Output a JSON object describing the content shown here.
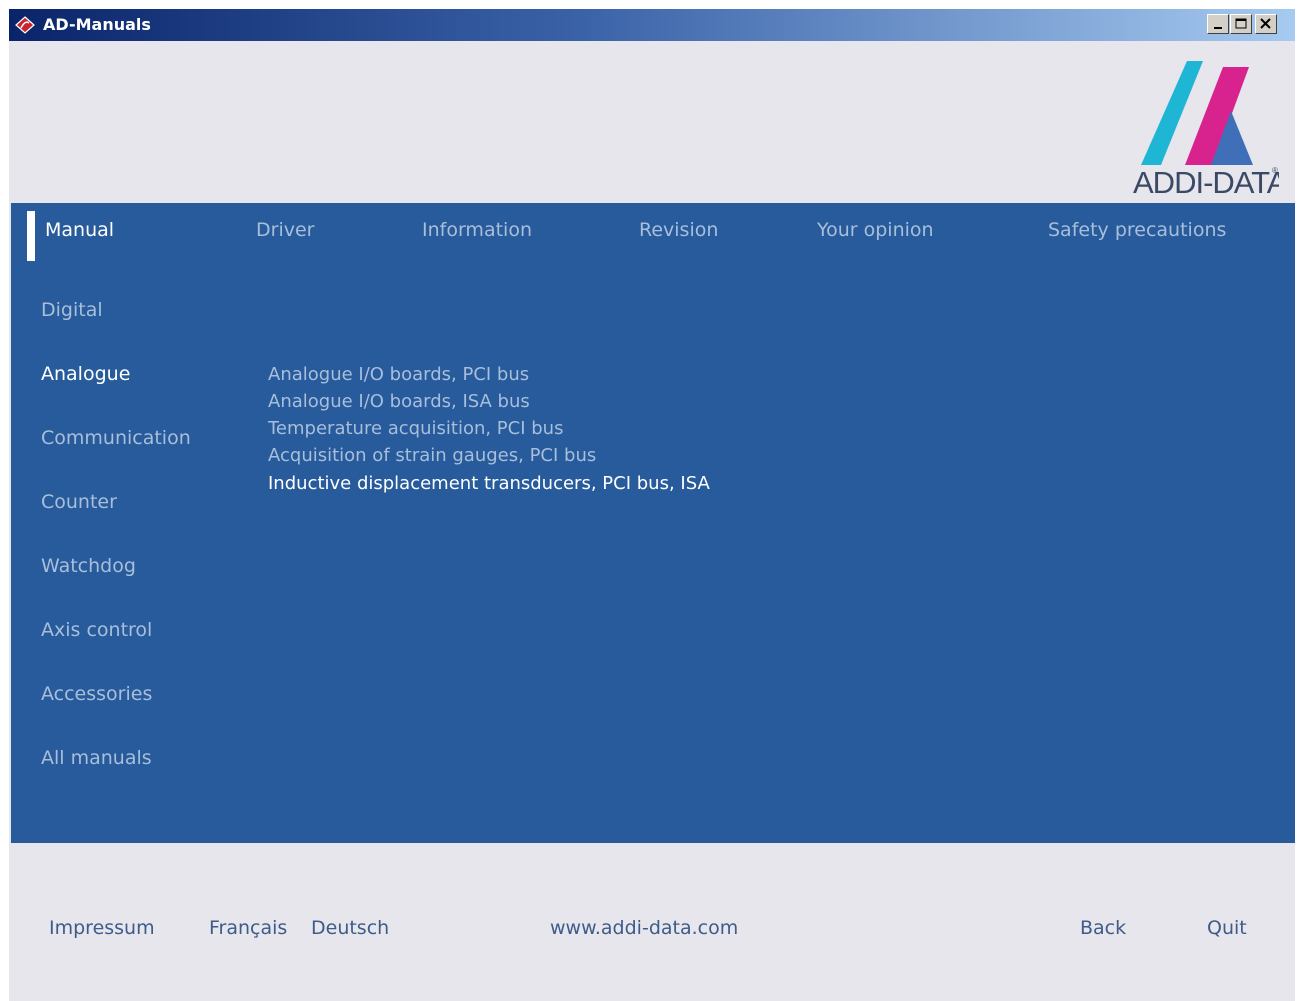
{
  "window": {
    "title": "AD-Manuals",
    "app_icon": "diamond-app-icon",
    "controls": [
      "minimize-icon",
      "maximize-icon",
      "close-icon"
    ]
  },
  "logo": {
    "text": "ADDI-DATA",
    "mark": "®",
    "colors": [
      "#1fb6d6",
      "#d8238f",
      "#3e6fb8"
    ]
  },
  "top_nav": {
    "items": [
      {
        "label": "Manual",
        "active": true
      },
      {
        "label": "Driver"
      },
      {
        "label": "Information"
      },
      {
        "label": "Revision"
      },
      {
        "label": "Your opinion"
      },
      {
        "label": "Safety precautions"
      }
    ]
  },
  "categories": {
    "items": [
      {
        "label": "Digital"
      },
      {
        "label": "Analogue",
        "active": true
      },
      {
        "label": "Communication"
      },
      {
        "label": "Counter"
      },
      {
        "label": "Watchdog"
      },
      {
        "label": "Axis control"
      },
      {
        "label": "Accessories"
      },
      {
        "label": "All manuals"
      }
    ]
  },
  "subitems": {
    "items": [
      {
        "label": "Analogue I/O boards, PCI bus"
      },
      {
        "label": "Analogue I/O boards, ISA bus"
      },
      {
        "label": "Temperature acquisition, PCI bus"
      },
      {
        "label": "Acquisition of strain gauges, PCI bus"
      },
      {
        "label": "Inductive displacement transducers, PCI bus, ISA",
        "active": true
      }
    ]
  },
  "footer": {
    "impressum": "Impressum",
    "francais": "Français",
    "deutsch": "Deutsch",
    "website": "www.addi-data.com",
    "back": "Back",
    "quit": "Quit"
  },
  "colors": {
    "panel": "#275b9b",
    "active_text": "#ffffff",
    "inactive_text": "#a8bedb",
    "footer_text": "#3d5c8a",
    "window_bg": "#e6e6ec"
  }
}
